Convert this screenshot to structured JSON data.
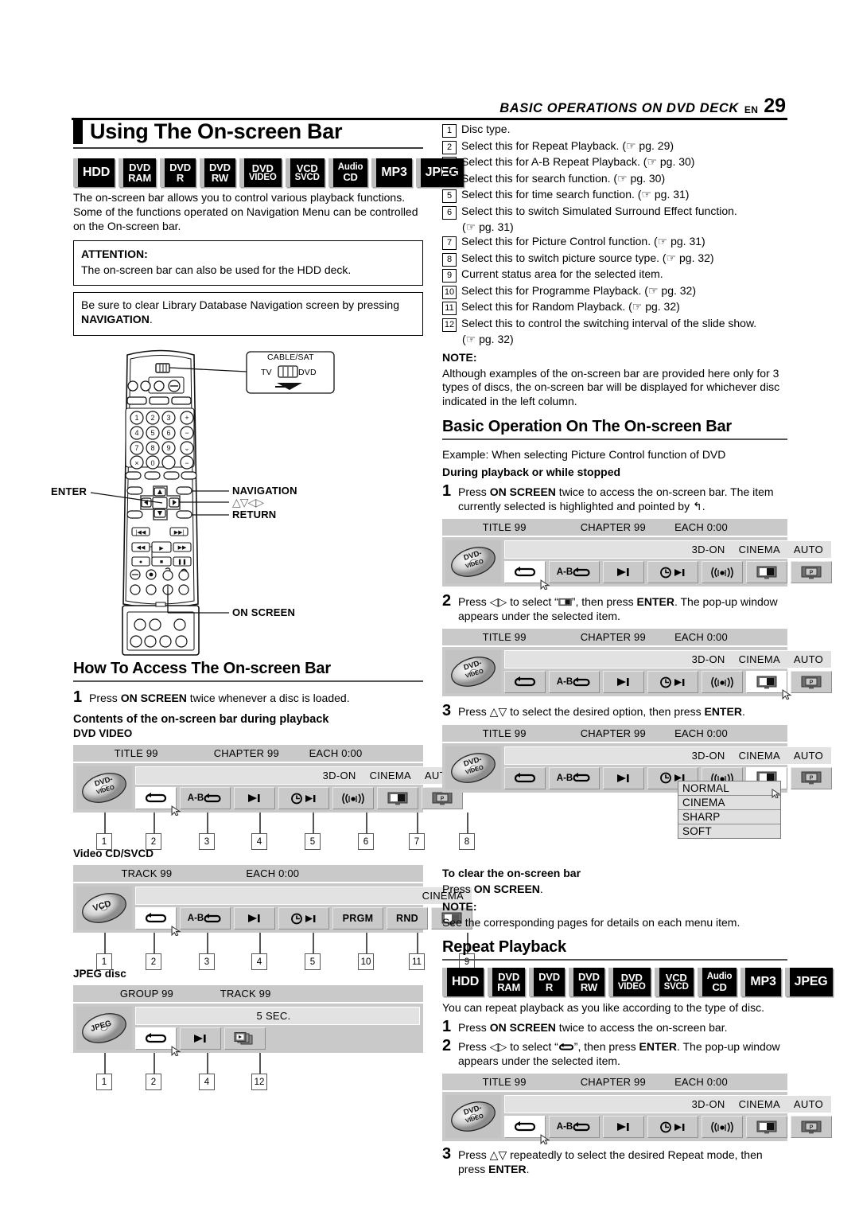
{
  "header": {
    "title": "BASIC OPERATIONS ON DVD DECK",
    "lang": "EN",
    "page": "29"
  },
  "left": {
    "title": "Using The On-screen Bar",
    "badges": [
      {
        "name": "hdd",
        "l1": "HDD",
        "l2": ""
      },
      {
        "name": "dvd-ram",
        "l1": "DVD",
        "l2": "RAM"
      },
      {
        "name": "dvd-r",
        "l1": "DVD",
        "l2": "R"
      },
      {
        "name": "dvd-rw",
        "l1": "DVD",
        "l2": "RW"
      },
      {
        "name": "dvd-video",
        "l1": "DVD",
        "l2": "VIDEO"
      },
      {
        "name": "vcd-svcd",
        "l1": "VCD",
        "l2": "SVCD"
      },
      {
        "name": "audio-cd",
        "l1": "Audio",
        "l2": "CD"
      },
      {
        "name": "mp3",
        "l1": "MP3",
        "l2": ""
      },
      {
        "name": "jpeg",
        "l1": "JPEG",
        "l2": ""
      }
    ],
    "intro": "The on-screen bar allows you to control various playback functions. Some of the functions operated on Navigation Menu can be controlled on the On-screen bar.",
    "attention_label": "ATTENTION:",
    "attention_text": "The on-screen bar can also be used for the HDD deck.",
    "note_box_text_1": "Be sure to clear Library Database Navigation screen by pressing ",
    "note_box_bold": "NAVIGATION",
    "note_box_text_2": ".",
    "remote": {
      "callout_cable_sat": "CABLE/SAT",
      "callout_tv": "TV",
      "callout_dvd": "DVD",
      "label_enter": "ENTER",
      "label_navigation": "NAVIGATION",
      "label_arrows": "△▽◁▷",
      "label_return": "RETURN",
      "label_on_screen": "ON SCREEN",
      "keys": [
        "1",
        "2",
        "3",
        "4",
        "5",
        "6",
        "7",
        "8",
        "9",
        "0"
      ]
    },
    "how_to_title": "How To Access The On-screen Bar",
    "how_to_step1_num": "1",
    "how_to_step1_pre": "Press ",
    "how_to_step1_bold": "ON SCREEN",
    "how_to_step1_post": " twice whenever a disc is loaded.",
    "contents_title": "Contents of the on-screen bar during playback",
    "dvd_video_label": "DVD VIDEO",
    "video_cd_label": "Video CD/SVCD",
    "jpeg_label": "JPEG disc"
  },
  "right": {
    "items": [
      {
        "n": "1",
        "text": "Disc type."
      },
      {
        "n": "2",
        "text": "Select this for Repeat Playback. (☞ pg. 29)"
      },
      {
        "n": "3",
        "text": "Select this for A-B Repeat Playback. (☞ pg. 30)"
      },
      {
        "n": "4",
        "text": "Select this for search function. (☞ pg. 30)"
      },
      {
        "n": "5",
        "text": "Select this for time search function. (☞ pg. 31)"
      },
      {
        "n": "6",
        "text": "Select this to switch Simulated Surround Effect function.",
        "sub": "(☞ pg. 31)"
      },
      {
        "n": "7",
        "text": "Select this for Picture Control function. (☞ pg. 31)"
      },
      {
        "n": "8",
        "text": "Select this to switch picture source type. (☞ pg. 32)"
      },
      {
        "n": "9",
        "text": "Current status area for the selected item."
      },
      {
        "n": "10",
        "text": "Select this for Programme Playback. (☞ pg. 32)"
      },
      {
        "n": "11",
        "text": "Select this for Random Playback. (☞ pg. 32)"
      },
      {
        "n": "12",
        "text": "Select this to control the switching interval of the slide show.",
        "sub": "(☞ pg. 32)"
      }
    ],
    "note1_label": "NOTE:",
    "note1_text": "Although examples of the on-screen bar are provided here only for 3 types of discs, the on-screen bar will be displayed for whichever disc indicated in the left column.",
    "basic_op_title": "Basic Operation On The On-screen Bar",
    "example_text": "Example: When selecting Picture Control function of DVD",
    "during_label": "During playback or while stopped",
    "step1": {
      "num": "1",
      "pre": "Press ",
      "bold": "ON SCREEN",
      "post": " twice to access the on-screen bar. The item currently selected is highlighted and pointed by ↰."
    },
    "step2": {
      "num": "2",
      "pre": "Press ◁▷ to select “",
      "icon": "picture-control-icon",
      "post": "”, then press ",
      "bold": "ENTER",
      "post2": ". The pop-up window appears under the selected item."
    },
    "step3": {
      "num": "3",
      "pre": "Press △▽ to select the desired option, then press ",
      "bold": "ENTER",
      "post": "."
    },
    "popup_options": [
      "NORMAL",
      "CINEMA",
      "SHARP",
      "SOFT"
    ],
    "clear_title": "To clear the on-screen bar",
    "clear_pre": "Press ",
    "clear_bold": "ON SCREEN",
    "clear_post": ".",
    "note2_label": "NOTE:",
    "note2_text": "See the corresponding pages for details on each menu item.",
    "repeat_title": "Repeat Playback",
    "repeat_intro": "You can repeat playback as you like according to the type of disc.",
    "rstep1": {
      "num": "1",
      "pre": "Press ",
      "bold": "ON SCREEN",
      "post": " twice to access the on-screen bar."
    },
    "rstep2": {
      "num": "2",
      "pre": "Press ◁▷ to select “",
      "icon": "repeat-icon",
      "post": "”, then press ",
      "bold": "ENTER",
      "post2": ". The pop-up window appears under the selected item."
    },
    "rstep3": {
      "num": "3",
      "pre": "Press △▽ repeatedly to select the desired Repeat mode, then press ",
      "bold": "ENTER",
      "post": "."
    }
  },
  "osb": {
    "dvd_video": {
      "disc_l1": "DVD-",
      "disc_l2": "VIDEO",
      "top": [
        "TITLE 99",
        "CHAPTER 99",
        "EACH 0:00"
      ],
      "status": [
        "3D-ON",
        "CINEMA",
        "AUTO"
      ],
      "icons": [
        "repeat-icon",
        "ab-repeat-icon",
        "search-icon",
        "time-search-icon",
        "surround-icon",
        "picture-control-icon",
        "source-type-icon"
      ],
      "callouts": [
        "1",
        "2",
        "3",
        "4",
        "5",
        "6",
        "7",
        "8"
      ]
    },
    "vcd": {
      "disc_l1": "VCD",
      "top": [
        "TRACK 99",
        "EACH 0:00"
      ],
      "status": [
        "CINEMA"
      ],
      "icons": [
        "repeat-icon",
        "ab-repeat-icon",
        "search-icon",
        "time-search-icon",
        "PRGM",
        "RND",
        "source-type-icon"
      ],
      "callouts": [
        "1",
        "2",
        "3",
        "4",
        "5",
        "10",
        "11",
        "9"
      ]
    },
    "jpeg": {
      "disc_l1": "JPEG",
      "top": [
        "GROUP 99",
        "TRACK 99"
      ],
      "status": [
        "5 SEC."
      ],
      "icons": [
        "repeat-icon",
        "search-icon",
        "slideshow-icon"
      ],
      "callouts": [
        "1",
        "2",
        "4",
        "12"
      ]
    },
    "labels": {
      "prgm": "PRGM",
      "rnd": "RND"
    }
  }
}
